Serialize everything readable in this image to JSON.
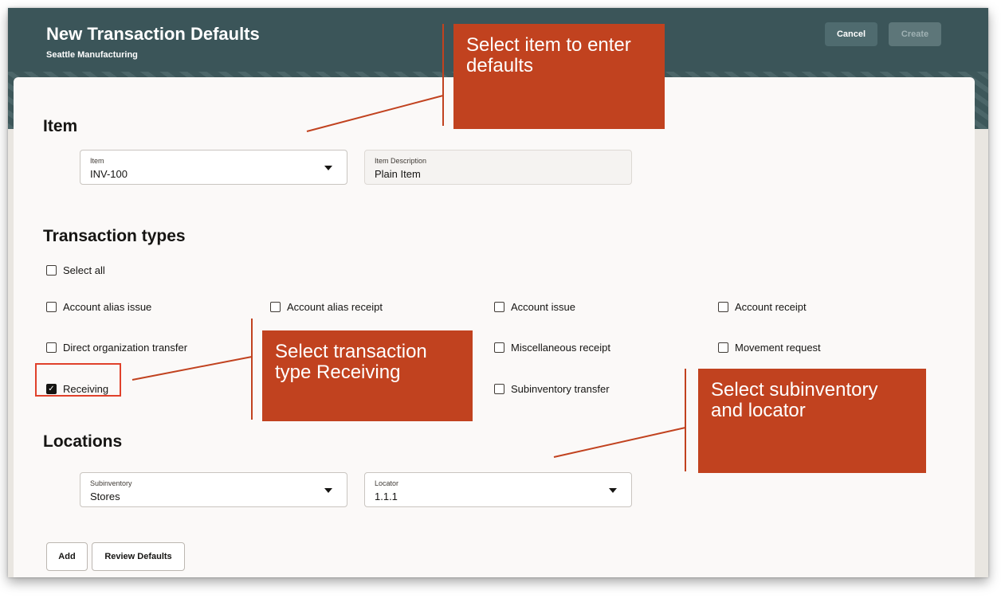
{
  "header": {
    "title": "New Transaction Defaults",
    "subtitle": "Seattle Manufacturing",
    "cancel_label": "Cancel",
    "create_label": "Create"
  },
  "item_section": {
    "title": "Item",
    "item_field": {
      "label": "Item",
      "value": "INV-100"
    },
    "description_field": {
      "label": "Item Description",
      "value": "Plain Item"
    }
  },
  "transaction_types": {
    "title": "Transaction types",
    "select_all": {
      "label": "Select all",
      "checked": false
    },
    "options": [
      {
        "label": "Account alias issue",
        "checked": false
      },
      {
        "label": "Account alias receipt",
        "checked": false
      },
      {
        "label": "Account issue",
        "checked": false
      },
      {
        "label": "Account receipt",
        "checked": false
      },
      {
        "label": "Direct organization transfer",
        "checked": false
      },
      {
        "label": "Miscellaneous receipt",
        "checked": false
      },
      {
        "label": "Movement request",
        "checked": false
      },
      {
        "label": "Receiving",
        "checked": true
      },
      {
        "label": "Subinventory transfer",
        "checked": false
      }
    ]
  },
  "locations": {
    "title": "Locations",
    "subinventory_field": {
      "label": "Subinventory",
      "value": "Stores"
    },
    "locator_field": {
      "label": "Locator",
      "value": "1.1.1"
    }
  },
  "actions": {
    "add_label": "Add",
    "review_label": "Review Defaults"
  },
  "callouts": {
    "item": "Select item to enter defaults",
    "transaction": "Select transaction type Receiving",
    "location": "Select subinventory and locator"
  },
  "colors": {
    "header_bg": "#3b5559",
    "callout_bg": "#c1421f",
    "highlight_border": "#e0412b"
  },
  "icons": {
    "dropdown": "caret-down-icon",
    "checkbox_checked": "check-icon"
  }
}
